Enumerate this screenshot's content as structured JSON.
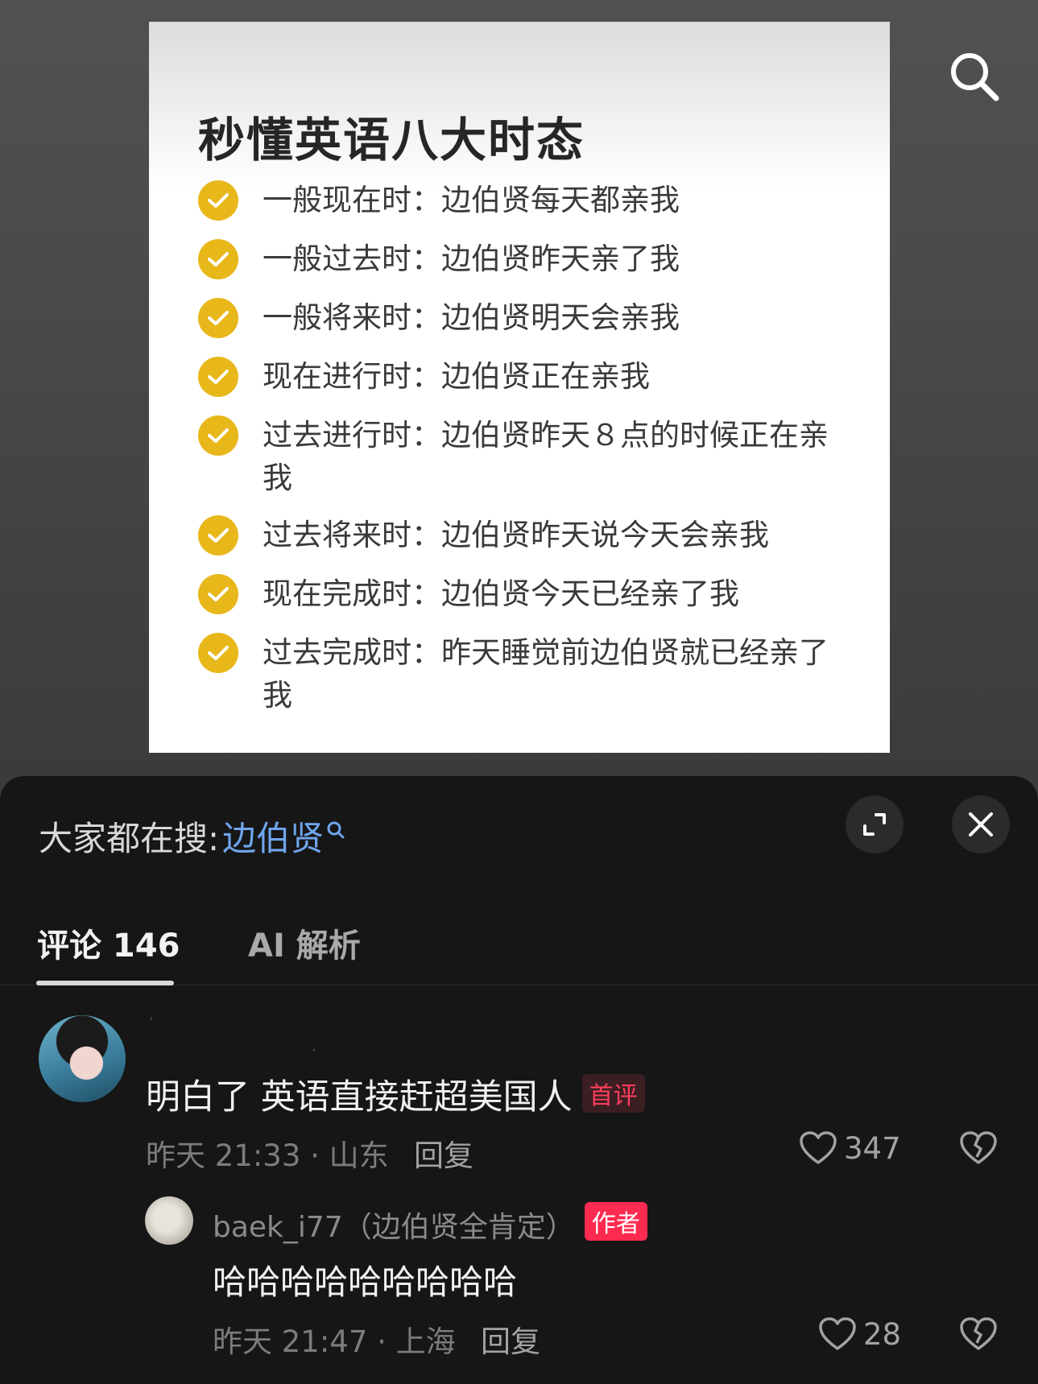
{
  "post": {
    "title": "秒懂英语八大时态",
    "tenses": [
      {
        "name": "一般现在时：",
        "example": "边伯贤每天都亲我"
      },
      {
        "name": "一般过去时：",
        "example": "边伯贤昨天亲了我"
      },
      {
        "name": "一般将来时：",
        "example": "边伯贤明天会亲我"
      },
      {
        "name": "现在进行时：",
        "example": "边伯贤正在亲我"
      },
      {
        "name": "过去进行时：",
        "example": "边伯贤昨天８点的时候正在亲我"
      },
      {
        "name": "过去将来时：",
        "example": "边伯贤昨天说今天会亲我"
      },
      {
        "name": "现在完成时：",
        "example": "边伯贤今天已经亲了我"
      },
      {
        "name": "过去完成时：",
        "example": "昨天睡觉前边伯贤就已经亲了我"
      }
    ],
    "check_color": "#e8b71a"
  },
  "header": {
    "search_icon": "search-icon"
  },
  "sheet": {
    "hot_search_label": "大家都在搜:",
    "hot_search_keyword": "边伯贤",
    "expand_icon": "expand-icon",
    "close_icon": "close-icon",
    "link_color": "#6fa5ee"
  },
  "tabs": {
    "comments_label": "评论 146",
    "ai_label": "AI 解析"
  },
  "comments": [
    {
      "username": "",
      "text": "明白了  英语直接赶超美国人",
      "badge": "首评",
      "time_location": "昨天 21:33 · 山东",
      "reply_label": "回复",
      "likes": "347",
      "replies": [
        {
          "username": "baek_i77（边伯贤全肯定）",
          "badge": "作者",
          "text": "哈哈哈哈哈哈哈哈哈",
          "time_location": "昨天 21:47 · 上海",
          "reply_label": "回复",
          "likes": "28"
        }
      ]
    }
  ]
}
